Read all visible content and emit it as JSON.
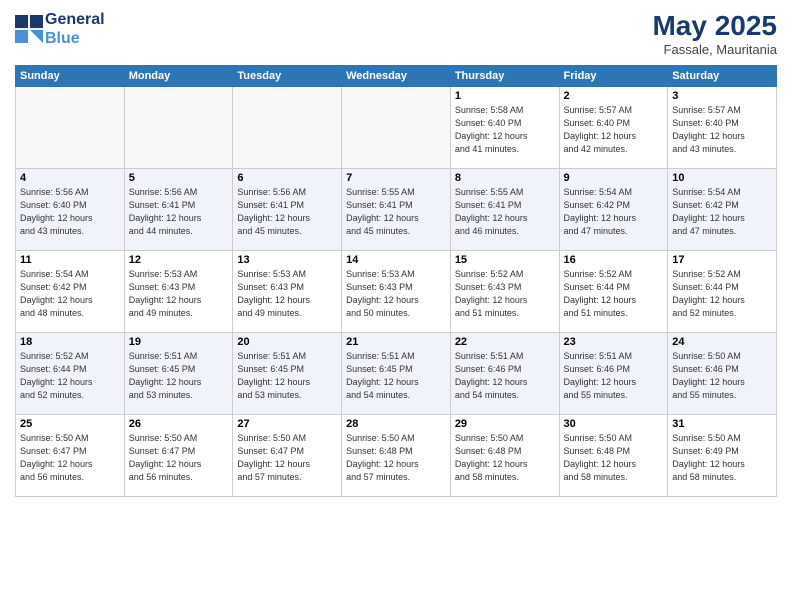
{
  "header": {
    "logo_line1": "General",
    "logo_line2": "Blue",
    "month": "May 2025",
    "location": "Fassale, Mauritania"
  },
  "days_of_week": [
    "Sunday",
    "Monday",
    "Tuesday",
    "Wednesday",
    "Thursday",
    "Friday",
    "Saturday"
  ],
  "weeks": [
    [
      {
        "day": "",
        "info": ""
      },
      {
        "day": "",
        "info": ""
      },
      {
        "day": "",
        "info": ""
      },
      {
        "day": "",
        "info": ""
      },
      {
        "day": "1",
        "info": "Sunrise: 5:58 AM\nSunset: 6:40 PM\nDaylight: 12 hours\nand 41 minutes."
      },
      {
        "day": "2",
        "info": "Sunrise: 5:57 AM\nSunset: 6:40 PM\nDaylight: 12 hours\nand 42 minutes."
      },
      {
        "day": "3",
        "info": "Sunrise: 5:57 AM\nSunset: 6:40 PM\nDaylight: 12 hours\nand 43 minutes."
      }
    ],
    [
      {
        "day": "4",
        "info": "Sunrise: 5:56 AM\nSunset: 6:40 PM\nDaylight: 12 hours\nand 43 minutes."
      },
      {
        "day": "5",
        "info": "Sunrise: 5:56 AM\nSunset: 6:41 PM\nDaylight: 12 hours\nand 44 minutes."
      },
      {
        "day": "6",
        "info": "Sunrise: 5:56 AM\nSunset: 6:41 PM\nDaylight: 12 hours\nand 45 minutes."
      },
      {
        "day": "7",
        "info": "Sunrise: 5:55 AM\nSunset: 6:41 PM\nDaylight: 12 hours\nand 45 minutes."
      },
      {
        "day": "8",
        "info": "Sunrise: 5:55 AM\nSunset: 6:41 PM\nDaylight: 12 hours\nand 46 minutes."
      },
      {
        "day": "9",
        "info": "Sunrise: 5:54 AM\nSunset: 6:42 PM\nDaylight: 12 hours\nand 47 minutes."
      },
      {
        "day": "10",
        "info": "Sunrise: 5:54 AM\nSunset: 6:42 PM\nDaylight: 12 hours\nand 47 minutes."
      }
    ],
    [
      {
        "day": "11",
        "info": "Sunrise: 5:54 AM\nSunset: 6:42 PM\nDaylight: 12 hours\nand 48 minutes."
      },
      {
        "day": "12",
        "info": "Sunrise: 5:53 AM\nSunset: 6:43 PM\nDaylight: 12 hours\nand 49 minutes."
      },
      {
        "day": "13",
        "info": "Sunrise: 5:53 AM\nSunset: 6:43 PM\nDaylight: 12 hours\nand 49 minutes."
      },
      {
        "day": "14",
        "info": "Sunrise: 5:53 AM\nSunset: 6:43 PM\nDaylight: 12 hours\nand 50 minutes."
      },
      {
        "day": "15",
        "info": "Sunrise: 5:52 AM\nSunset: 6:43 PM\nDaylight: 12 hours\nand 51 minutes."
      },
      {
        "day": "16",
        "info": "Sunrise: 5:52 AM\nSunset: 6:44 PM\nDaylight: 12 hours\nand 51 minutes."
      },
      {
        "day": "17",
        "info": "Sunrise: 5:52 AM\nSunset: 6:44 PM\nDaylight: 12 hours\nand 52 minutes."
      }
    ],
    [
      {
        "day": "18",
        "info": "Sunrise: 5:52 AM\nSunset: 6:44 PM\nDaylight: 12 hours\nand 52 minutes."
      },
      {
        "day": "19",
        "info": "Sunrise: 5:51 AM\nSunset: 6:45 PM\nDaylight: 12 hours\nand 53 minutes."
      },
      {
        "day": "20",
        "info": "Sunrise: 5:51 AM\nSunset: 6:45 PM\nDaylight: 12 hours\nand 53 minutes."
      },
      {
        "day": "21",
        "info": "Sunrise: 5:51 AM\nSunset: 6:45 PM\nDaylight: 12 hours\nand 54 minutes."
      },
      {
        "day": "22",
        "info": "Sunrise: 5:51 AM\nSunset: 6:46 PM\nDaylight: 12 hours\nand 54 minutes."
      },
      {
        "day": "23",
        "info": "Sunrise: 5:51 AM\nSunset: 6:46 PM\nDaylight: 12 hours\nand 55 minutes."
      },
      {
        "day": "24",
        "info": "Sunrise: 5:50 AM\nSunset: 6:46 PM\nDaylight: 12 hours\nand 55 minutes."
      }
    ],
    [
      {
        "day": "25",
        "info": "Sunrise: 5:50 AM\nSunset: 6:47 PM\nDaylight: 12 hours\nand 56 minutes."
      },
      {
        "day": "26",
        "info": "Sunrise: 5:50 AM\nSunset: 6:47 PM\nDaylight: 12 hours\nand 56 minutes."
      },
      {
        "day": "27",
        "info": "Sunrise: 5:50 AM\nSunset: 6:47 PM\nDaylight: 12 hours\nand 57 minutes."
      },
      {
        "day": "28",
        "info": "Sunrise: 5:50 AM\nSunset: 6:48 PM\nDaylight: 12 hours\nand 57 minutes."
      },
      {
        "day": "29",
        "info": "Sunrise: 5:50 AM\nSunset: 6:48 PM\nDaylight: 12 hours\nand 58 minutes."
      },
      {
        "day": "30",
        "info": "Sunrise: 5:50 AM\nSunset: 6:48 PM\nDaylight: 12 hours\nand 58 minutes."
      },
      {
        "day": "31",
        "info": "Sunrise: 5:50 AM\nSunset: 6:49 PM\nDaylight: 12 hours\nand 58 minutes."
      }
    ]
  ]
}
